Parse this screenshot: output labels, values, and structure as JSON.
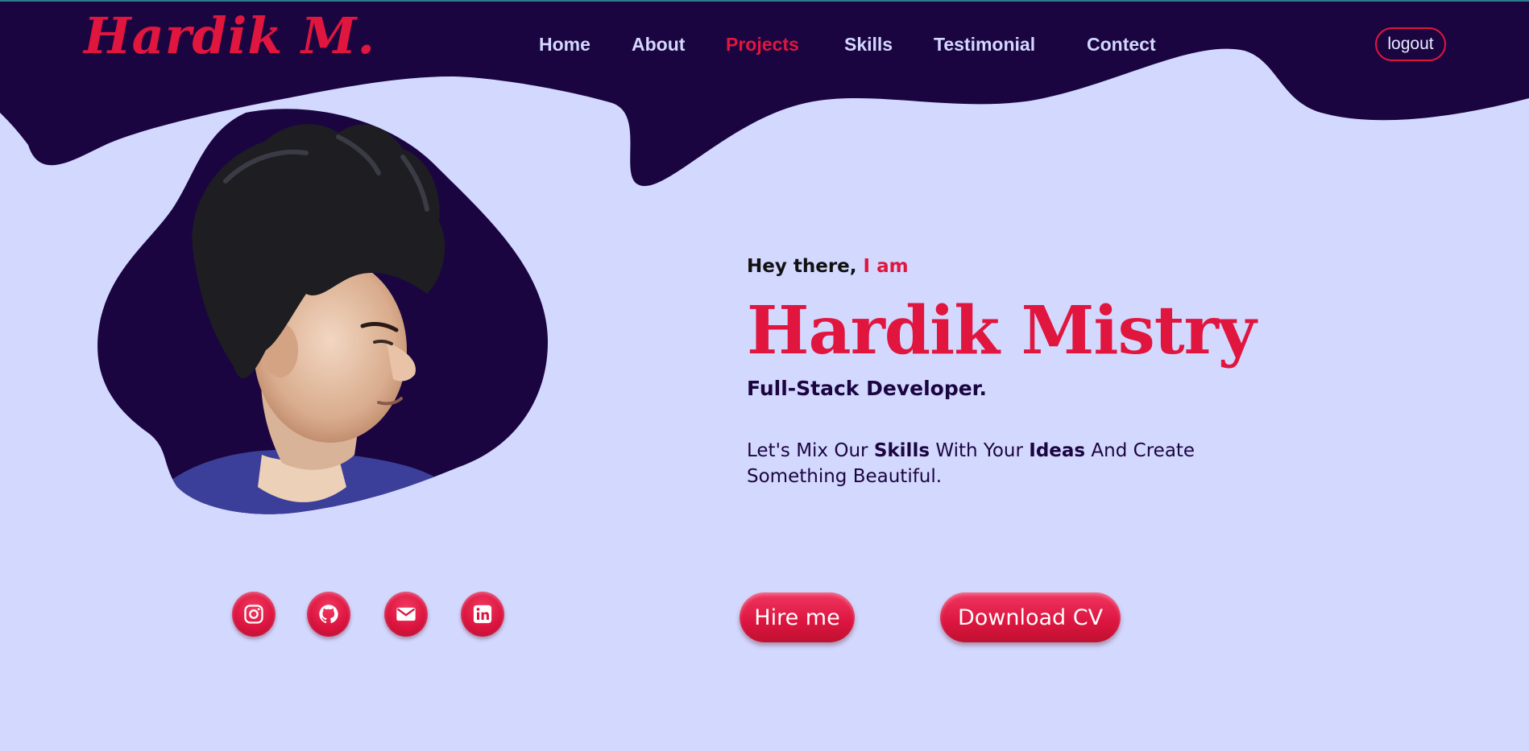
{
  "colors": {
    "background": "#d3d8ff",
    "dark": "#1b0540",
    "accent": "#e0163f",
    "nav_text": "#d3d8ff"
  },
  "header": {
    "logo": "Hardik M.",
    "nav": [
      {
        "label": "Home",
        "active": false
      },
      {
        "label": "About",
        "active": false
      },
      {
        "label": "Projects",
        "active": true
      },
      {
        "label": "Skills",
        "active": false
      },
      {
        "label": "Testimonial",
        "active": false
      },
      {
        "label": "Contect",
        "active": false
      }
    ],
    "logout_label": "logout"
  },
  "hero": {
    "greeting": "Hey there,",
    "greeting_accent": "I am",
    "name": "Hardik Mistry",
    "role": "Full-Stack Developer.",
    "tagline": {
      "part1": "Let's Mix Our ",
      "bold1": "Skills",
      "part2": " With Your ",
      "bold2": "Ideas",
      "part3": " And Create Something Beautiful."
    },
    "hire_label": "Hire me",
    "download_label": "Download CV"
  },
  "social": [
    {
      "icon": "instagram-icon"
    },
    {
      "icon": "github-icon"
    },
    {
      "icon": "mail-icon"
    },
    {
      "icon": "linkedin-icon"
    }
  ]
}
